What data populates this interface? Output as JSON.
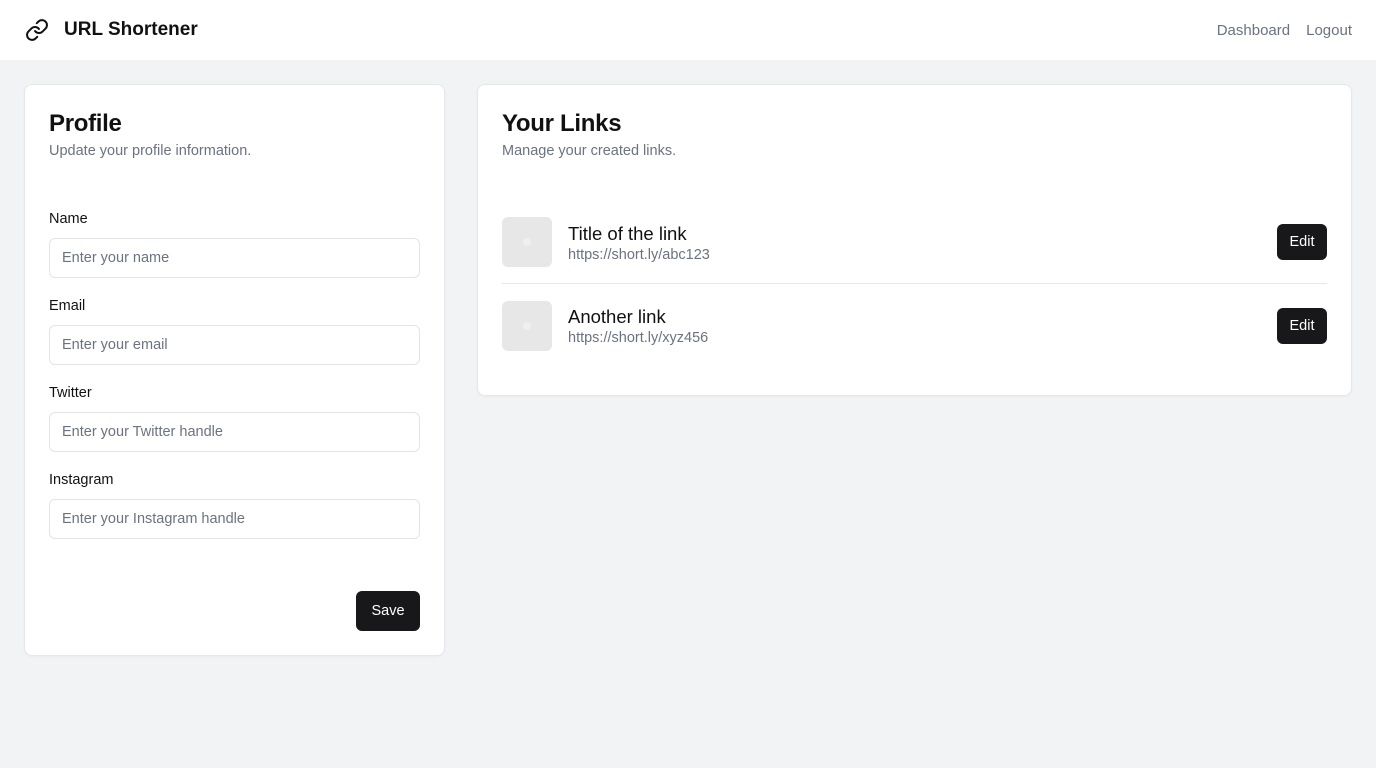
{
  "app": {
    "title": "URL Shortener"
  },
  "nav": {
    "dashboard": "Dashboard",
    "logout": "Logout"
  },
  "profile": {
    "title": "Profile",
    "subtitle": "Update your profile information.",
    "fields": [
      {
        "label": "Name",
        "placeholder": "Enter your name",
        "value": ""
      },
      {
        "label": "Email",
        "placeholder": "Enter your email",
        "value": ""
      },
      {
        "label": "Twitter",
        "placeholder": "Enter your Twitter handle",
        "value": ""
      },
      {
        "label": "Instagram",
        "placeholder": "Enter your Instagram handle",
        "value": ""
      }
    ],
    "save_label": "Save"
  },
  "links": {
    "title": "Your Links",
    "subtitle": "Manage your created links.",
    "items": [
      {
        "title": "Title of the link",
        "url": "https://short.ly/abc123",
        "edit_label": "Edit"
      },
      {
        "title": "Another link",
        "url": "https://short.ly/xyz456",
        "edit_label": "Edit"
      }
    ]
  },
  "colors": {
    "accent": "#18181b",
    "background": "#f2f3f5",
    "muted_text": "#6b7280",
    "border": "#e5e7eb"
  },
  "icons": {
    "brand": "link-icon"
  }
}
